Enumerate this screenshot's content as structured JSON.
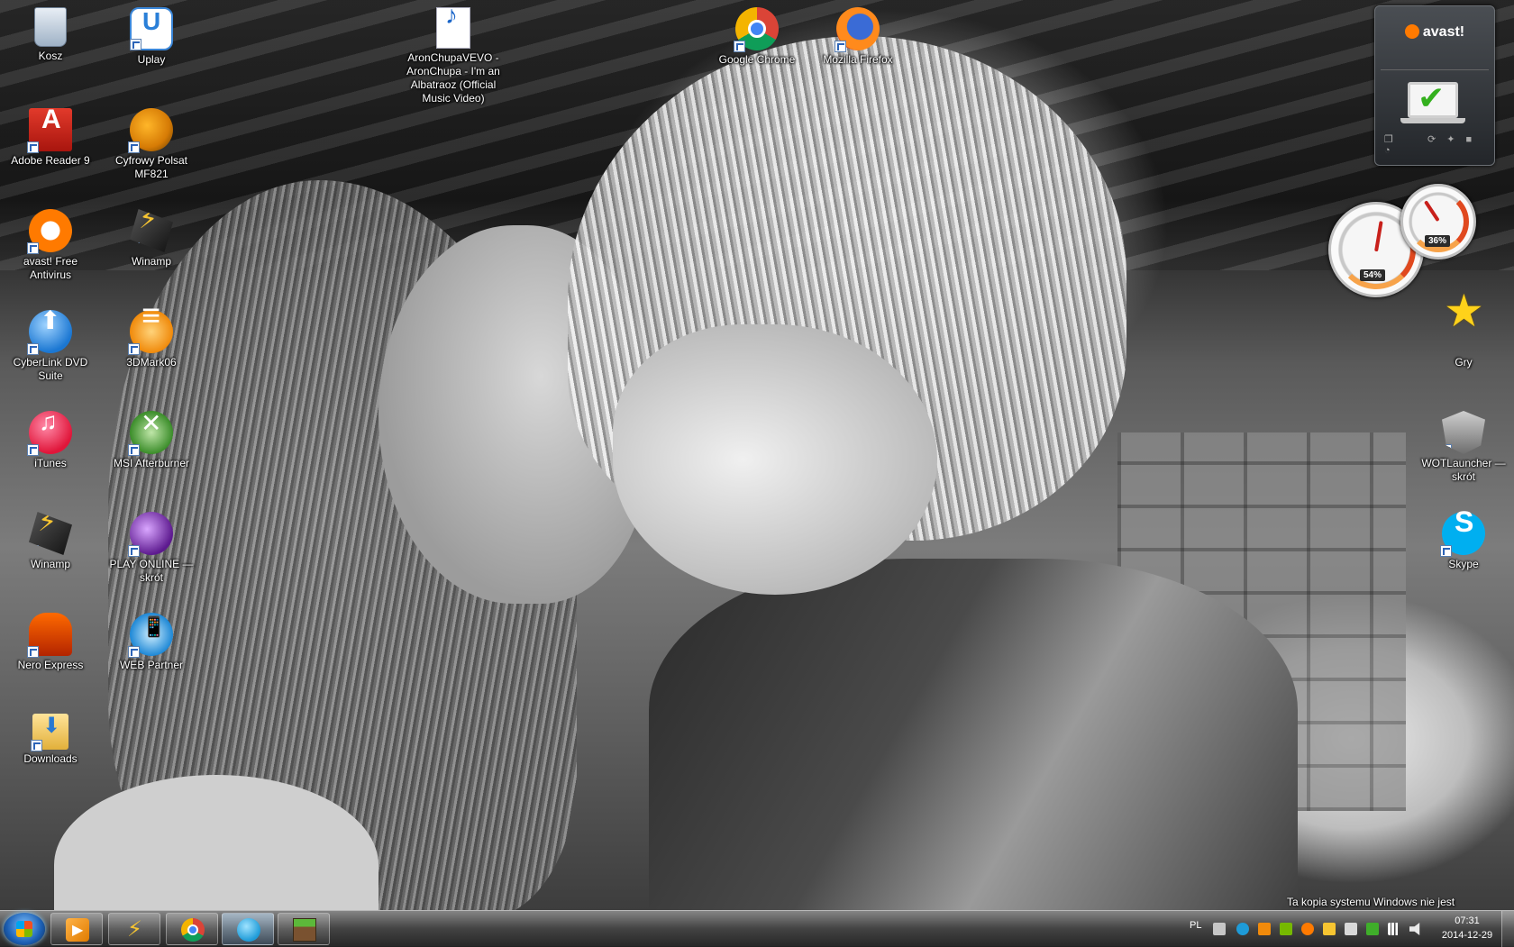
{
  "desktop": {
    "icons": [
      {
        "label": "Kosz",
        "icon": "recycle-bin-icon"
      },
      {
        "label": "Uplay",
        "icon": "uplay-icon"
      },
      {
        "label": "AronChupaVEVO - AronChupa - I'm an Albatraoz (Official Music Video)",
        "icon": "mp3-file-icon"
      },
      {
        "label": "Google Chrome",
        "icon": "chrome-icon"
      },
      {
        "label": "Mozilla Firefox",
        "icon": "firefox-icon"
      },
      {
        "label": "Adobe Reader 9",
        "icon": "adobe-reader-icon"
      },
      {
        "label": "Cyfrowy Polsat MF821",
        "icon": "cyfrowy-polsat-icon"
      },
      {
        "label": "avast! Free Antivirus",
        "icon": "avast-icon"
      },
      {
        "label": "Winamp",
        "icon": "winamp-icon"
      },
      {
        "label": "CyberLink DVD Suite",
        "icon": "cyberlink-icon"
      },
      {
        "label": "3DMark06",
        "icon": "3dmark-icon"
      },
      {
        "label": "iTunes",
        "icon": "itunes-icon"
      },
      {
        "label": "MSI Afterburner",
        "icon": "msi-afterburner-icon"
      },
      {
        "label": "Winamp",
        "icon": "winamp-icon"
      },
      {
        "label": "PLAY ONLINE — skrót",
        "icon": "play-online-icon"
      },
      {
        "label": "Nero Express",
        "icon": "nero-icon"
      },
      {
        "label": "WEB Partner",
        "icon": "web-partner-icon"
      },
      {
        "label": "Downloads",
        "icon": "downloads-folder-icon"
      },
      {
        "label": "Gry",
        "icon": "games-star-icon"
      },
      {
        "label": "WOTLauncher — skrót",
        "icon": "wot-launcher-icon"
      },
      {
        "label": "Skype",
        "icon": "skype-icon"
      }
    ]
  },
  "gadgets": {
    "avast": {
      "brand": "avast!",
      "status": "protected"
    },
    "meter": {
      "cpu_readout": "54%",
      "cpu_value": 54,
      "memory_readout": "36%",
      "memory_value": 36
    }
  },
  "watermark": "Ta kopia systemu Windows nie jest",
  "taskbar": {
    "pinned": [
      {
        "name": "windows-media-player",
        "icon": "media-player-icon"
      },
      {
        "name": "winamp",
        "icon": "winamp-icon"
      },
      {
        "name": "google-chrome",
        "icon": "chrome-icon"
      },
      {
        "name": "blue-app",
        "icon": "blue-circle-icon",
        "active": true
      },
      {
        "name": "minecraft",
        "icon": "minecraft-icon"
      }
    ],
    "tray": {
      "language": "PL",
      "time": "07:31",
      "date": "2014-12-29"
    }
  },
  "colors": {
    "taskbar": "#4a4a4a",
    "avast_orange": "#ff7a00",
    "start_orb": "#1c5fb3"
  }
}
